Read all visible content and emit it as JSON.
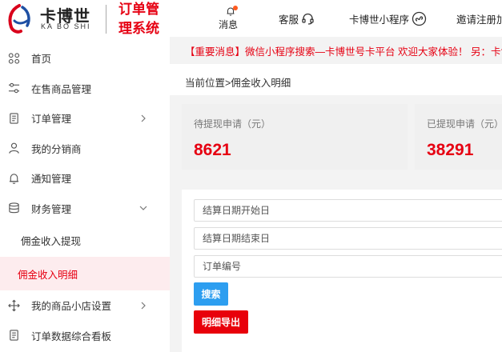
{
  "brand": {
    "logo_cn": "卡博世",
    "logo_en": "KA BO SHI",
    "system_title": "订单管理系统"
  },
  "sidebar": {
    "items": [
      {
        "label": "首页",
        "icon": "grid-icon"
      },
      {
        "label": "在售商品管理",
        "icon": "sliders-icon"
      },
      {
        "label": "订单管理",
        "icon": "document-icon",
        "arrow": "chevron-right"
      },
      {
        "label": "我的分销商",
        "icon": "user-icon"
      },
      {
        "label": "通知管理",
        "icon": "bell-icon"
      },
      {
        "label": "财务管理",
        "icon": "database-icon",
        "arrow": "chevron-down"
      }
    ],
    "sub_items": [
      {
        "label": "佣金收入提现",
        "active": false
      },
      {
        "label": "佣金收入明细",
        "active": true
      }
    ],
    "items_after": [
      {
        "label": "我的商品小店设置",
        "icon": "move-icon",
        "arrow": "chevron-right"
      },
      {
        "label": "订单数据综合看板",
        "icon": "document-icon"
      }
    ]
  },
  "topbar": {
    "notice_label": "消息",
    "service_label": "客服",
    "mini_program_label": "卡博世小程序",
    "invite_label": "邀请注册加"
  },
  "announcement": "【重要消息】微信小程序搜索—卡博世号卡平台 欢迎大家体验！ 另：卡博世",
  "breadcrumb": "当前位置>佣金收入明细",
  "stats": [
    {
      "label": "待提现申请（元）",
      "value": "8621"
    },
    {
      "label": "已提现申请（元）",
      "value": "38291"
    }
  ],
  "filters": {
    "start_date_placeholder": "结算日期开始日",
    "end_date_placeholder": "结算日期结束日",
    "order_no_placeholder": "订单编号"
  },
  "buttons": {
    "search": "搜索",
    "export": "明细导出"
  },
  "colors": {
    "accent_red": "#e60012",
    "button_blue": "#2d9ef0",
    "notice_dot": "#ff5a1f"
  }
}
